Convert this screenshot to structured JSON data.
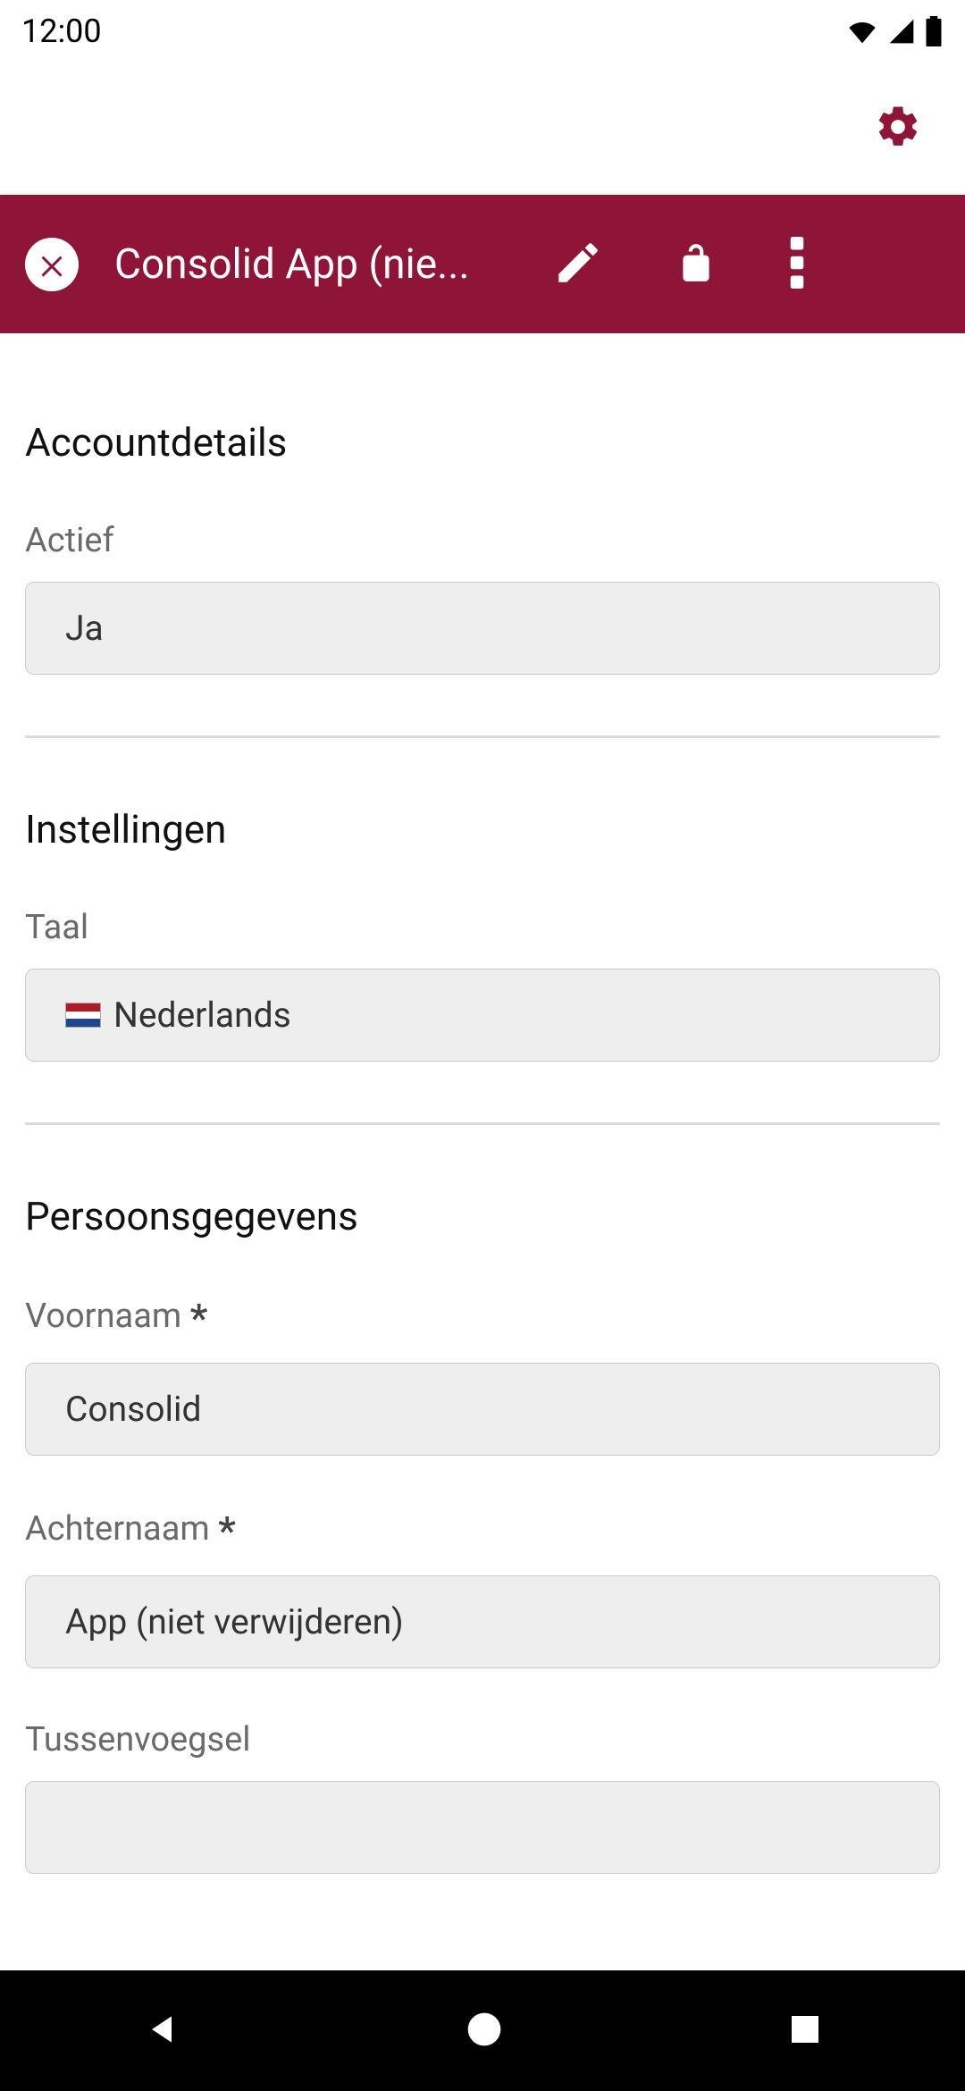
{
  "status": {
    "time": "12:00"
  },
  "appbar": {
    "title": "Consolid App (nie..."
  },
  "sections": {
    "account": {
      "title": "Accountdetails",
      "active": {
        "label": "Actief",
        "value": "Ja"
      }
    },
    "settings": {
      "title": "Instellingen",
      "language": {
        "label": "Taal",
        "value": "Nederlands"
      }
    },
    "personal": {
      "title": "Persoonsgegevens",
      "firstname": {
        "label": "Voornaam",
        "value": "Consolid"
      },
      "lastname": {
        "label": "Achternaam",
        "value": "App (niet verwijderen)"
      },
      "infix": {
        "label": "Tussenvoegsel",
        "value": ""
      }
    }
  }
}
